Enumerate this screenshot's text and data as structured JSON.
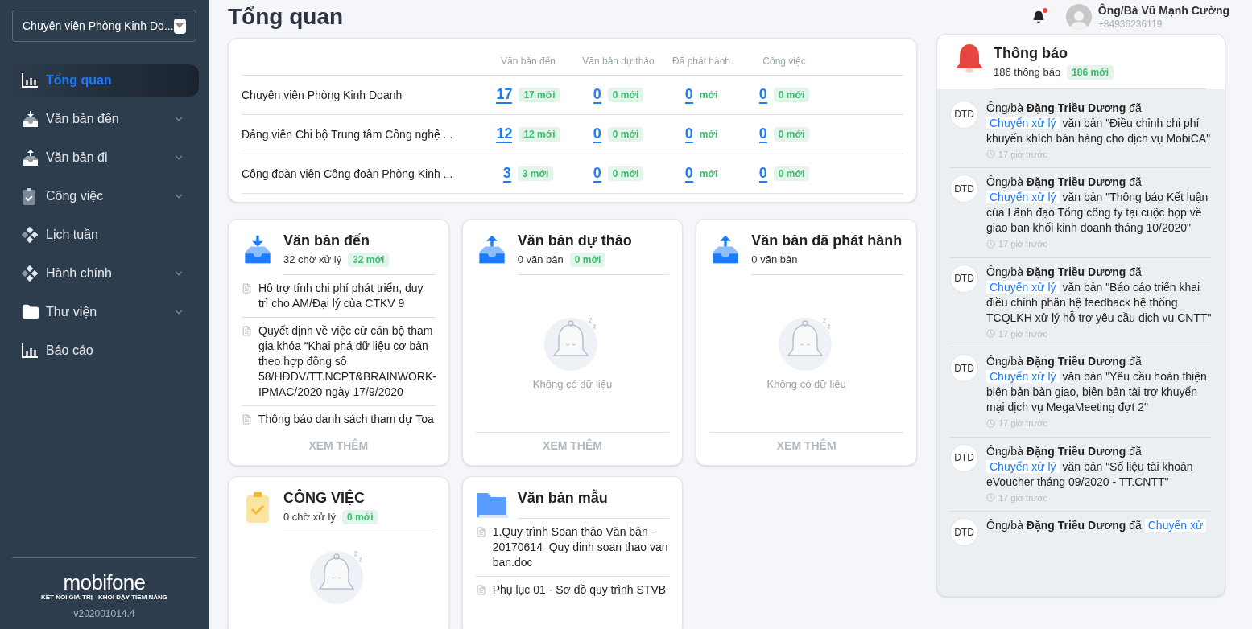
{
  "sidebar": {
    "role_select": {
      "value": "Chuyên viên Phòng Kinh Do..."
    },
    "items": [
      {
        "label": "Tổng quan",
        "selected": true,
        "expandable": false
      },
      {
        "label": "Văn bản đến",
        "selected": false,
        "expandable": true
      },
      {
        "label": "Văn bản đi",
        "selected": false,
        "expandable": true
      },
      {
        "label": "Công việc",
        "selected": false,
        "expandable": true
      },
      {
        "label": "Lịch tuần",
        "selected": false,
        "expandable": false
      },
      {
        "label": "Hành chính",
        "selected": false,
        "expandable": true
      },
      {
        "label": "Thư viện",
        "selected": false,
        "expandable": true
      },
      {
        "label": "Báo cáo",
        "selected": false,
        "expandable": false
      }
    ],
    "logo": {
      "name": "mobifone",
      "tagline": "KẾT NỐI GIÁ TRỊ - KHOI DẬY TIỀM NĂNG"
    },
    "version": "v202001014.4"
  },
  "page_title": "Tổng quan",
  "user": {
    "name": "Ông/Bà Vũ Mạnh Cường",
    "phone": "+84936236119",
    "has_unread": true
  },
  "summary_table": {
    "columns": [
      "Văn bản đến",
      "Văn bản dự thảo",
      "Đã phát hành",
      "Công việc"
    ],
    "rows": [
      {
        "name": "Chuyên viên Phòng Kinh Doanh",
        "cells": [
          {
            "count": "17",
            "new": "17 mới",
            "kind": "badge"
          },
          {
            "count": "0",
            "new": "0 mới",
            "kind": "badge"
          },
          {
            "count": "0",
            "new": "mới",
            "kind": "text"
          },
          {
            "count": "0",
            "new": "0 mới",
            "kind": "badge"
          }
        ]
      },
      {
        "name": "Đảng viên Chi bộ Trung tâm Công nghệ ...",
        "cells": [
          {
            "count": "12",
            "new": "12 mới",
            "kind": "badge"
          },
          {
            "count": "0",
            "new": "0 mới",
            "kind": "badge"
          },
          {
            "count": "0",
            "new": "mới",
            "kind": "text"
          },
          {
            "count": "0",
            "new": "0 mới",
            "kind": "badge"
          }
        ]
      },
      {
        "name": "Công đoàn viên Công đoàn Phòng Kinh ...",
        "cells": [
          {
            "count": "3",
            "new": "3 mới",
            "kind": "badge"
          },
          {
            "count": "0",
            "new": "0 mới",
            "kind": "badge"
          },
          {
            "count": "0",
            "new": "mới",
            "kind": "text"
          },
          {
            "count": "0",
            "new": "0 mới",
            "kind": "badge"
          }
        ]
      }
    ]
  },
  "cards": [
    {
      "title": "Văn bản đến",
      "subtitle": "32 chờ xử lý",
      "badge": "32 mới",
      "items": [
        "Hỗ trợ tính chi phí phát triển, duy trì cho AM/Đại lý của CTKV 9",
        "Quyết định về việc cử cán bộ tham gia khóa “Khai phá dữ liệu cơ bản theo hợp đồng số 58/HĐDV/TT.NCPT&BRAINWORK-IPMAC/2020 ngày 17/9/2020",
        "Thông báo danh sách tham dự Toa"
      ],
      "more": "XEM THÊM"
    },
    {
      "title": "Văn bản dự thảo",
      "subtitle": "0 văn bản",
      "badge": "0 mới",
      "empty": "Không có dữ liệu",
      "more": "XEM THÊM"
    },
    {
      "title": "Văn bản đã phát hành",
      "subtitle": "0 văn bản",
      "empty": "Không có dữ liệu",
      "more": "XEM THÊM"
    },
    {
      "title": "CÔNG VIỆC",
      "subtitle": "0 chờ xử lý",
      "badge": "0 mới",
      "empty_icon": true
    },
    {
      "title": "Văn bản mẫu",
      "items": [
        "1.Quy trình Soạn thảo Văn bản - 20170614_Quy dinh soan thao van ban.doc",
        "Phụ lục 01 - Sơ đồ quy trình STVB"
      ]
    }
  ],
  "notifications": {
    "title": "Thông báo",
    "count": "186 thông báo",
    "badge": "186 mới",
    "items": [
      {
        "initials": "DTD",
        "text": "Ông/bà **Đặng Triều Dương** đã",
        "link": "Chuyển xử lý",
        "document": "văn bản \"Điều chỉnh chi phí khuyến khích bán hàng cho dịch vụ MobiCA\"",
        "time": "17 giờ trước"
      },
      {
        "initials": "DTD",
        "text": "Ông/bà **Đặng Triều Dương** đã",
        "link": "Chuyển xử lý",
        "document": "văn bản \"Thông báo Kết luận của Lãnh đạo Tổng công ty tại cuộc họp về giao ban khối kinh doanh tháng 10/2020\"",
        "time": "17 giờ trước"
      },
      {
        "initials": "DTD",
        "text": "Ông/bà **Đặng Triều Dương** đã",
        "link": "Chuyển xử lý",
        "document": "văn bản \"Báo cáo triển khai điều chỉnh phân hệ feedback hệ thống TCQLKH xử lý hỗ trợ yêu cầu dịch vụ CNTT\"",
        "time": "17 giờ trước"
      },
      {
        "initials": "DTD",
        "text": "Ông/bà **Đặng Triều Dương** đã",
        "link": "Chuyển xử lý",
        "document": "văn bản \"Yêu cầu hoàn thiện biên bản bàn giao, biên bản tài trợ khuyến mại dịch vụ MegaMeeting đợt 2\"",
        "time": "17 giờ trước"
      },
      {
        "initials": "DTD",
        "text": "Ông/bà **Đặng Triều Dương** đã",
        "link": "Chuyển xử lý",
        "document": "văn bản \"Số liệu tài khoản eVoucher tháng 09/2020 - TT.CNTT\"",
        "time": "17 giờ trước"
      },
      {
        "initials": "DTD",
        "text": "Ông/bà **Đặng Triều Dương** đã",
        "link": "Chuyển xử"
      }
    ]
  }
}
